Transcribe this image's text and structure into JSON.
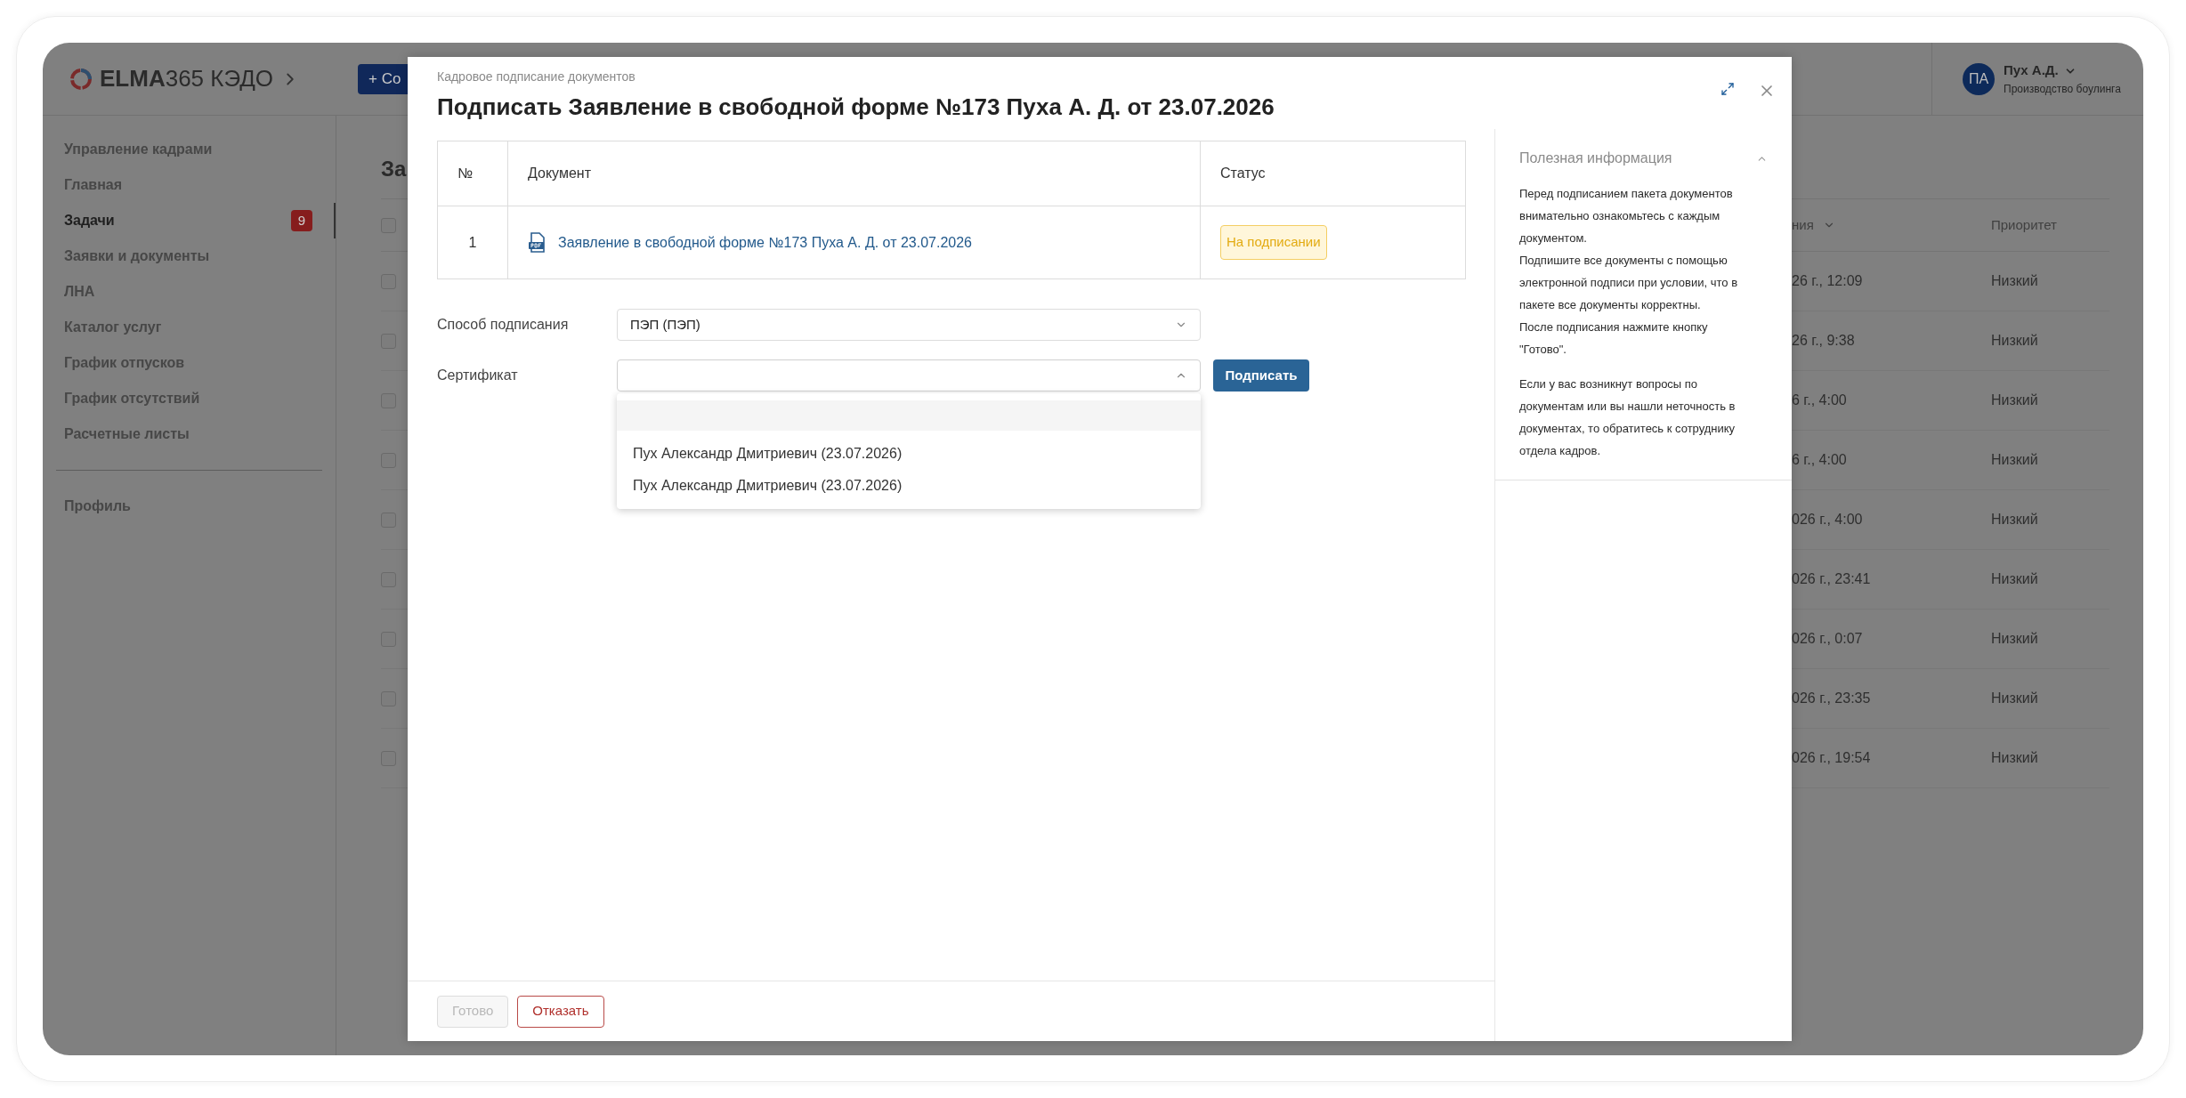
{
  "app": {
    "logo": {
      "brand": "ELMA",
      "product": "365 КЭДО"
    },
    "create_button": "+ Со",
    "user": {
      "initials": "ПА",
      "name": "Пух А.Д.",
      "department": "Производство боулинга"
    }
  },
  "sidebar": {
    "items": [
      {
        "label": "Управление кадрами",
        "selected": false
      },
      {
        "label": "Главная",
        "selected": false
      },
      {
        "label": "Задачи",
        "selected": true,
        "badge": "9"
      },
      {
        "label": "Заявки и документы",
        "selected": false
      },
      {
        "label": "ЛНА",
        "selected": false
      },
      {
        "label": "Каталог услуг",
        "selected": false
      },
      {
        "label": "График отпусков",
        "selected": false
      },
      {
        "label": "График отсутствий",
        "selected": false
      },
      {
        "label": "Расчетные листы",
        "selected": false
      }
    ],
    "footer_items": [
      {
        "label": "Профиль",
        "selected": false
      }
    ]
  },
  "page_title": "За",
  "tasks_table": {
    "all_checked": false,
    "columns": [
      "ния",
      "Приоритет"
    ],
    "rows": [
      {
        "checked": false,
        "column_1": "26 г., 12:09",
        "priority": "Низкий"
      },
      {
        "checked": false,
        "column_1": "26 г., 9:38",
        "priority": "Низкий"
      },
      {
        "checked": false,
        "column_1": "6 г., 4:00",
        "priority": "Низкий"
      },
      {
        "checked": false,
        "column_1": "6 г., 4:00",
        "priority": "Низкий"
      },
      {
        "checked": false,
        "column_1": "026 г., 4:00",
        "priority": "Низкий"
      },
      {
        "checked": false,
        "column_1": "026 г., 23:41",
        "priority": "Низкий"
      },
      {
        "checked": false,
        "column_1": "026 г., 0:07",
        "priority": "Низкий"
      },
      {
        "checked": false,
        "column_1": "026 г., 23:35",
        "priority": "Низкий"
      },
      {
        "checked": false,
        "column_1": "026 г., 19:54",
        "priority": "Низкий"
      }
    ]
  },
  "modal": {
    "subtitle": "Кадровое подписание документов",
    "title": "Подписать Заявление в свободной форме №173 Пуха А. Д. от 23.07.2026",
    "documents_table": {
      "columns": [
        "№",
        "Документ",
        "Статус"
      ],
      "rows": [
        {
          "number": "1",
          "document": "Заявление в свободной форме №173 Пуха А. Д. от 23.07.2026",
          "status": "На подписании"
        }
      ]
    },
    "fields": [
      {
        "label": "Способ подписания",
        "value": "ПЭП (ПЭП)",
        "expanded": false
      },
      {
        "label": "Сертификат",
        "expanded": true,
        "has_empty_option": true,
        "options": [
          {
            "label": "Пух Александр Дмитриевич (23.07.2026)",
            "selected": false
          },
          {
            "label": "Пух Александр Дмитриевич (23.07.2026)",
            "selected": false
          }
        ]
      }
    ],
    "sign_button": "Подписать",
    "info_panel": {
      "title": "Полезная информация",
      "expanded": true,
      "paragraphs": [
        [
          "Перед подписанием пакета документов внимательно ознакомьтесь с каждым документом.",
          "Подпишите все документы с помощью электронной подписи при условии, что в пакете все документы корректны.",
          "После подписания нажмите кнопку \"Готово\"."
        ],
        [
          "Если у вас возникнут вопросы по документам или вы нашли неточность в документах, то обратитесь к сотруднику отдела кадров."
        ]
      ]
    },
    "footer_buttons": [
      {
        "label": "Готово",
        "disabled": true
      },
      {
        "label": "Отказать",
        "kind": "danger",
        "disabled": false
      }
    ]
  }
}
